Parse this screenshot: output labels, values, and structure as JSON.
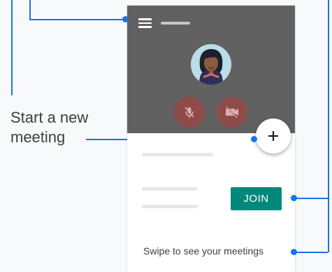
{
  "callouts": {
    "new_meeting_line1": "Start a new",
    "new_meeting_line2": "meeting"
  },
  "phone": {
    "menu_icon": "hamburger-menu-icon",
    "avatar_icon": "user-avatar",
    "mic_icon": "microphone-off-icon",
    "camera_icon": "camera-off-icon",
    "fab_icon": "plus-icon",
    "join_label": "JOIN",
    "swipe_hint": "Swipe to see your meetings"
  },
  "colors": {
    "accent": "#1a73e8",
    "header_bg": "#616161",
    "join_bg": "#00897b",
    "muted_control": "#8f4a4a"
  }
}
